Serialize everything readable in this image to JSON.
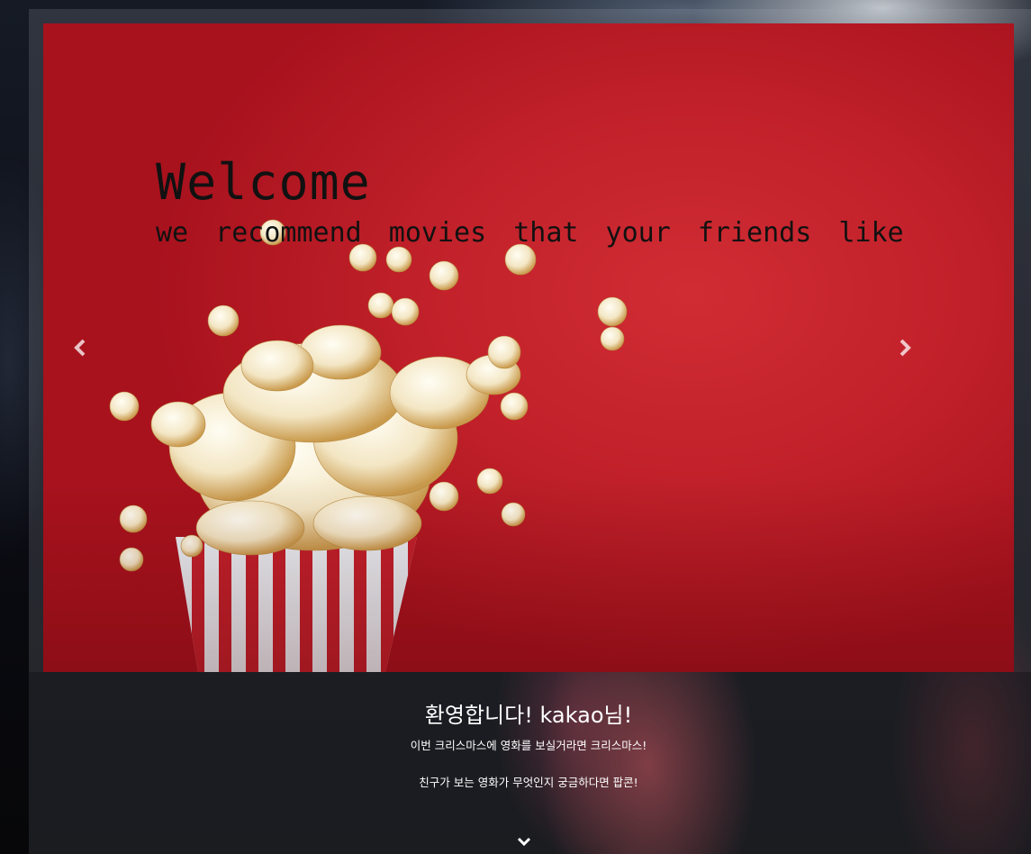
{
  "hero": {
    "title": "Welcome",
    "subtitle": "we recommend movies that your friends like",
    "prev_icon": "chevron-left-icon",
    "next_icon": "chevron-right-icon"
  },
  "welcome": {
    "heading": "환영합니다! kakao님!",
    "line1": "이번 크리스마스에 영화를 보실거라면 크리스마스!",
    "line2": "친구가 보는 영화가 무엇인지 궁금하다면 팝콘!"
  },
  "scroll": {
    "icon": "chevron-down-icon"
  },
  "colors": {
    "hero_background": "#c3222b",
    "text_light": "#ffffff",
    "text_dark": "#111111"
  }
}
